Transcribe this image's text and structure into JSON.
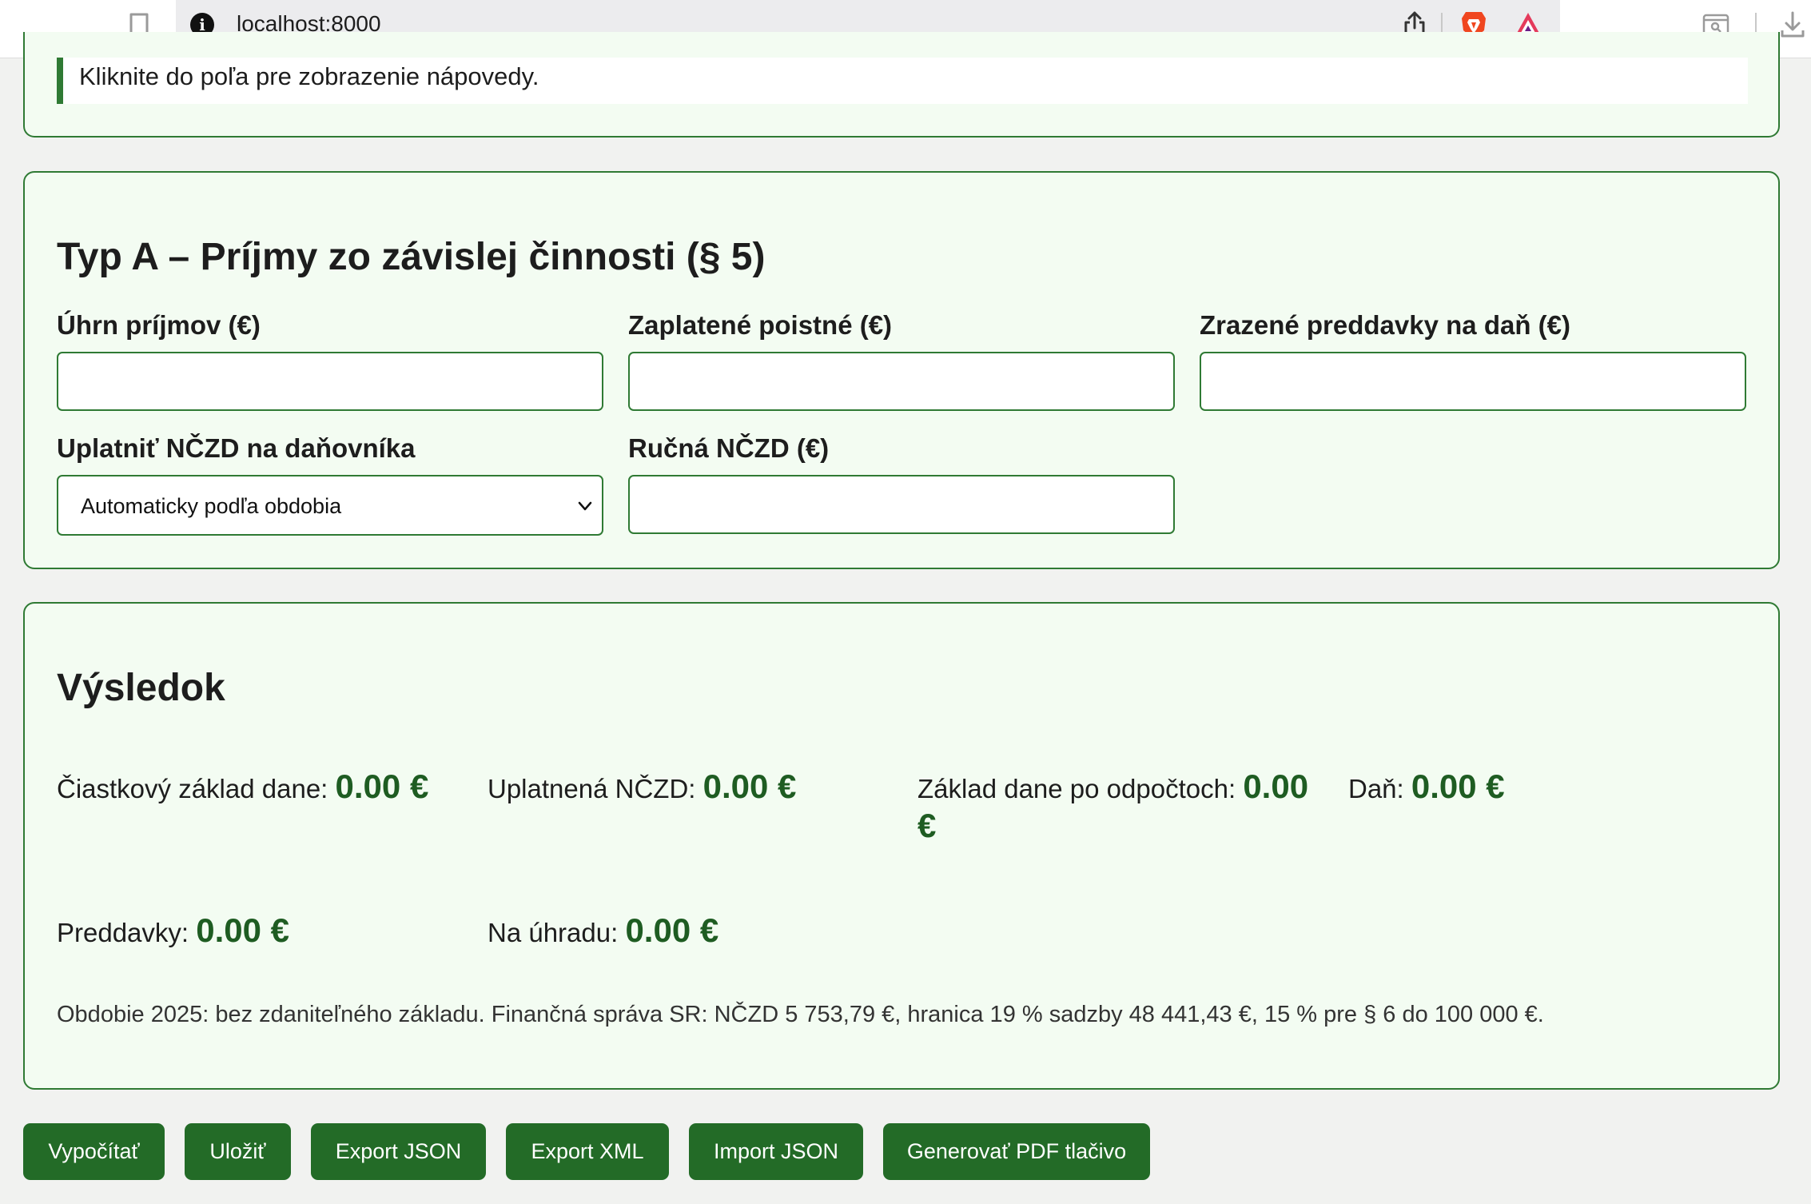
{
  "browser": {
    "url": "localhost:8000"
  },
  "help": {
    "text": "Kliknite do poľa pre zobrazenie nápovedy."
  },
  "type_a": {
    "title": "Typ A – Príjmy zo závislej činnosti (§ 5)",
    "fields": {
      "income_label": "Úhrn príjmov (€)",
      "income_value": "",
      "insurance_label": "Zaplatené poistné (€)",
      "insurance_value": "",
      "advances_label": "Zrazené preddavky na daň (€)",
      "advances_value": "",
      "nczd_label": "Uplatniť NČZD na daňovníka",
      "nczd_selected": "Automaticky podľa obdobia",
      "manual_nczd_label": "Ručná NČZD (€)",
      "manual_nczd_value": ""
    }
  },
  "result": {
    "title": "Výsledok",
    "partial_base_label": "Čiastkový základ dane:",
    "partial_base_value": "0.00 €",
    "applied_nczd_label": "Uplatnená NČZD:",
    "applied_nczd_value": "0.00 €",
    "base_after_label": "Základ dane po odpočtoch:",
    "base_after_value": "0.00 €",
    "tax_label": "Daň:",
    "tax_value": "0.00 €",
    "prepayments_label": "Preddavky:",
    "prepayments_value": "0.00 €",
    "to_pay_label": "Na úhradu:",
    "to_pay_value": "0.00 €",
    "note": "Obdobie 2025: bez zdaniteľného základu. Finančná správa SR: NČZD 5 753,79 €, hranica 19 % sadzby 48 441,43 €, 15 % pre § 6 do 100 000 €."
  },
  "actions": {
    "calculate": "Vypočítať",
    "save": "Uložiť",
    "export_json": "Export JSON",
    "export_xml": "Export XML",
    "import_json": "Import JSON",
    "generate_pdf": "Generovať PDF tlačivo"
  },
  "colors": {
    "accent": "#236b27",
    "panel_bg": "#f3fcf2",
    "border": "#2f7a34",
    "value_text": "#1e5c22"
  }
}
